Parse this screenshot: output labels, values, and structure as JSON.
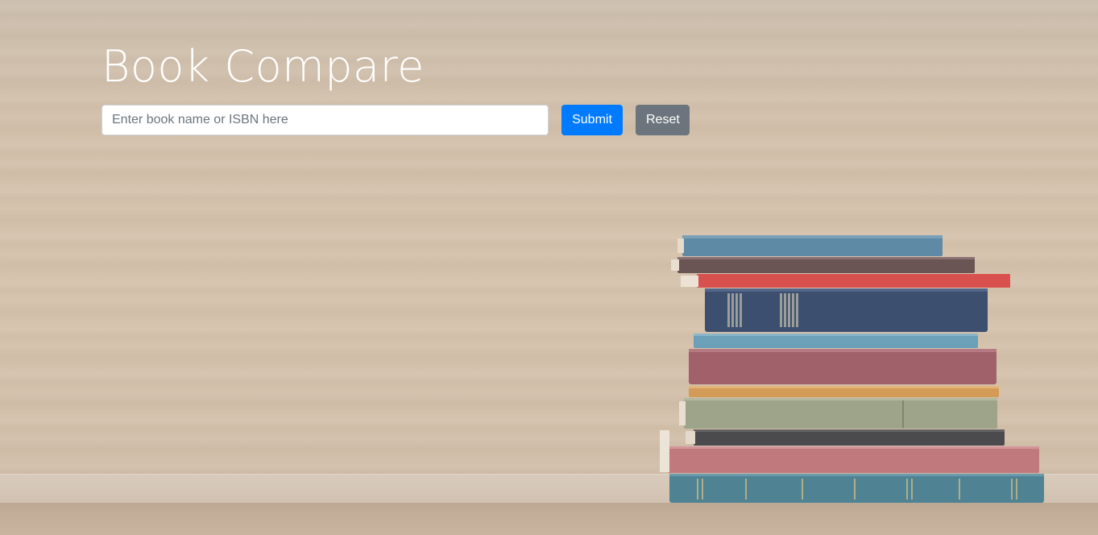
{
  "header": {
    "title": "Book Compare"
  },
  "search": {
    "placeholder": "Enter book name or ISBN here",
    "value": ""
  },
  "buttons": {
    "submit_label": "Submit",
    "reset_label": "Reset"
  },
  "colors": {
    "primary": "#007bff",
    "secondary": "#6c757d"
  }
}
